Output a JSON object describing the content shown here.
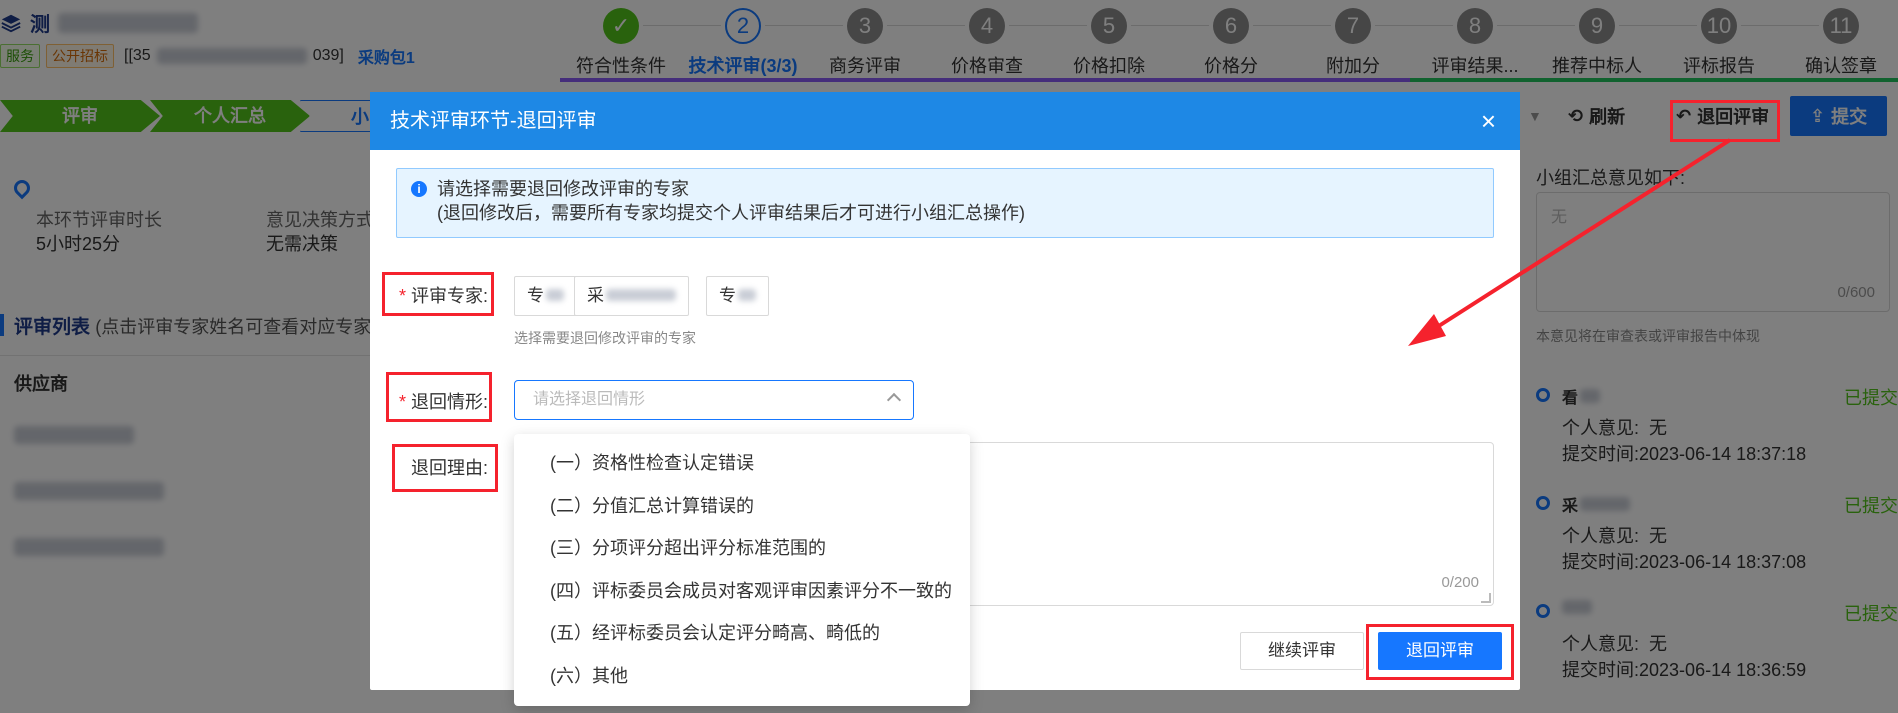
{
  "header": {
    "project_name": "测",
    "tags": [
      "服务",
      "公开招标"
    ],
    "project_code_start": "[[35",
    "project_code_end": "039]",
    "package": "采购包1"
  },
  "steps": [
    {
      "num": "✓",
      "label": "符合性条件",
      "state": "done"
    },
    {
      "num": "2",
      "label": "技术评审(3/3)",
      "state": "active"
    },
    {
      "num": "3",
      "label": "商务评审",
      "state": "todo"
    },
    {
      "num": "4",
      "label": "价格审查",
      "state": "todo"
    },
    {
      "num": "5",
      "label": "价格扣除",
      "state": "todo"
    },
    {
      "num": "6",
      "label": "价格分",
      "state": "todo"
    },
    {
      "num": "7",
      "label": "附加分",
      "state": "todo"
    },
    {
      "num": "8",
      "label": "评审结果...",
      "state": "todo"
    },
    {
      "num": "9",
      "label": "推荐中标人",
      "state": "todo"
    },
    {
      "num": "10",
      "label": "评标报告",
      "state": "todo"
    },
    {
      "num": "11",
      "label": "确认签章",
      "state": "todo"
    }
  ],
  "subbar": [
    "评审",
    "个人汇总",
    "小"
  ],
  "info": {
    "duration_label": "本环节评审时长",
    "duration_value": "5小时25分",
    "decision_label": "意见决策方式",
    "decision_value": "无需决策"
  },
  "list": {
    "title": "评审列表",
    "hint": "(点击评审专家姓名可查看对应专家评",
    "col_supplier": "供应商"
  },
  "right_panel": {
    "refresh_label": "刷新",
    "return_label": "退回评审",
    "submit_label": "提交",
    "opinion_label": "小组汇总意见如下:",
    "opinion_placeholder": "无",
    "opinion_count": "0/600",
    "opinion_note": "本意见将在审查表或评审报告中体现",
    "experts": [
      {
        "name": "看",
        "status": "已提交",
        "opinion_label": "个人意见:",
        "opinion": "无",
        "time_label": "提交时间:",
        "time": "2023-06-14 18:37:18"
      },
      {
        "name": "采",
        "status": "已提交",
        "opinion_label": "个人意见:",
        "opinion": "无",
        "time_label": "提交时间:",
        "time": "2023-06-14 18:37:08"
      },
      {
        "name": "",
        "status": "已提交",
        "opinion_label": "个人意见:",
        "opinion": "无",
        "time_label": "提交时间:",
        "time": "2023-06-14 18:36:59"
      }
    ]
  },
  "modal": {
    "title": "技术评审环节-退回评审",
    "close": "×",
    "alert_line1": "请选择需要退回修改评审的专家",
    "alert_line2": "(退回修改后，需要所有专家均提交个人评审结果后才可进行小组汇总操作)",
    "expert_label": "评审专家:",
    "expert_chips": [
      "专",
      "采",
      "专"
    ],
    "expert_help": "选择需要退回修改评审的专家",
    "situation_label": "退回情形:",
    "situation_placeholder": "请选择退回情形",
    "reason_label": "退回理由:",
    "reason_count": "0/200",
    "btn_continue": "继续评审",
    "btn_return": "退回评审"
  },
  "dropdown_options": [
    "(一）资格性检查认定错误",
    "(二）分值汇总计算错误的",
    "(三）分项评分超出评分标准范围的",
    "(四）评标委员会成员对客观评审因素评分不一致的",
    "(五）经评标委员会认定评分畸高、畸低的",
    "(六）其他"
  ]
}
